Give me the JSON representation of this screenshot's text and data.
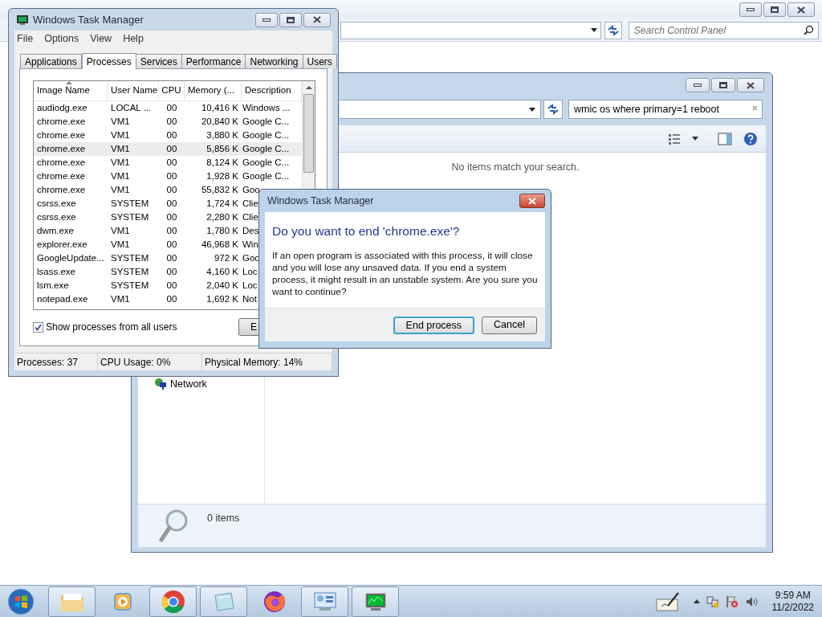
{
  "background_window": {
    "search": {
      "placeholder": "Search Control Panel"
    }
  },
  "explorer": {
    "search": {
      "value": "wmic os where primary=1 reboot",
      "clear": "×"
    },
    "message": "No items match your search.",
    "nav_items": [
      {
        "label": "Network"
      }
    ],
    "details": {
      "count": "0 items"
    }
  },
  "task_manager": {
    "title": "Windows Task Manager",
    "menu": [
      "File",
      "Options",
      "View",
      "Help"
    ],
    "tabs": [
      {
        "label": "Applications",
        "selected": false
      },
      {
        "label": "Processes",
        "selected": true
      },
      {
        "label": "Services",
        "selected": false
      },
      {
        "label": "Performance",
        "selected": false
      },
      {
        "label": "Networking",
        "selected": false
      },
      {
        "label": "Users",
        "selected": false
      }
    ],
    "columns": [
      "Image Name",
      "User Name",
      "CPU",
      "Memory (...",
      "Description"
    ],
    "rows": [
      {
        "cells": [
          "audiodg.exe",
          "LOCAL ...",
          "00",
          "10,416 K",
          "Windows ..."
        ],
        "selected": false
      },
      {
        "cells": [
          "chrome.exe",
          "VM1",
          "00",
          "20,840 K",
          "Google C..."
        ],
        "selected": false
      },
      {
        "cells": [
          "chrome.exe",
          "VM1",
          "00",
          "3,880 K",
          "Google C..."
        ],
        "selected": false
      },
      {
        "cells": [
          "chrome.exe",
          "VM1",
          "00",
          "5,856 K",
          "Google C..."
        ],
        "selected": true
      },
      {
        "cells": [
          "chrome.exe",
          "VM1",
          "00",
          "8,124 K",
          "Google C..."
        ],
        "selected": false
      },
      {
        "cells": [
          "chrome.exe",
          "VM1",
          "00",
          "1,928 K",
          "Google C..."
        ],
        "selected": false
      },
      {
        "cells": [
          "chrome.exe",
          "VM1",
          "00",
          "55,832 K",
          "Goo"
        ],
        "selected": false
      },
      {
        "cells": [
          "csrss.exe",
          "SYSTEM",
          "00",
          "1,724 K",
          "Clie"
        ],
        "selected": false
      },
      {
        "cells": [
          "csrss.exe",
          "SYSTEM",
          "00",
          "2,280 K",
          "Clie"
        ],
        "selected": false
      },
      {
        "cells": [
          "dwm.exe",
          "VM1",
          "00",
          "1,780 K",
          "Des"
        ],
        "selected": false
      },
      {
        "cells": [
          "explorer.exe",
          "VM1",
          "00",
          "46,968 K",
          "Win"
        ],
        "selected": false
      },
      {
        "cells": [
          "GoogleUpdate...",
          "SYSTEM",
          "00",
          "972 K",
          "Goo"
        ],
        "selected": false
      },
      {
        "cells": [
          "lsass.exe",
          "SYSTEM",
          "00",
          "4,160 K",
          "Loc"
        ],
        "selected": false
      },
      {
        "cells": [
          "lsm.exe",
          "SYSTEM",
          "00",
          "2,040 K",
          "Loc"
        ],
        "selected": false
      },
      {
        "cells": [
          "notepad.exe",
          "VM1",
          "00",
          "1,692 K",
          "Not"
        ],
        "selected": false
      }
    ],
    "show_all_users": {
      "label": "Show processes from all users",
      "checked": true
    },
    "end_button": "E",
    "status_bar": [
      "Processes: 37",
      "CPU Usage: 0%",
      "Physical Memory: 14%"
    ]
  },
  "dialog": {
    "title": "Windows Task Manager",
    "heading": "Do you want to end 'chrome.exe'?",
    "body": "If an open program is associated with this process, it will close and you will lose any unsaved data. If you end a system process, it might result in an unstable system. Are you sure you want to continue?",
    "buttons": [
      {
        "label": "End process",
        "default": true
      },
      {
        "label": "Cancel",
        "default": false
      }
    ]
  },
  "taskbar": {
    "apps": [
      {
        "kind": "folder",
        "running": true
      },
      {
        "kind": "player",
        "running": false
      },
      {
        "kind": "browser",
        "running": true
      },
      {
        "kind": "notepad",
        "running": true
      },
      {
        "kind": "firefox",
        "running": false
      },
      {
        "kind": "panel",
        "running": true
      },
      {
        "kind": "monitor",
        "running": true
      }
    ],
    "clock": {
      "time": "9:59 AM",
      "date": "11/2/2022"
    }
  }
}
